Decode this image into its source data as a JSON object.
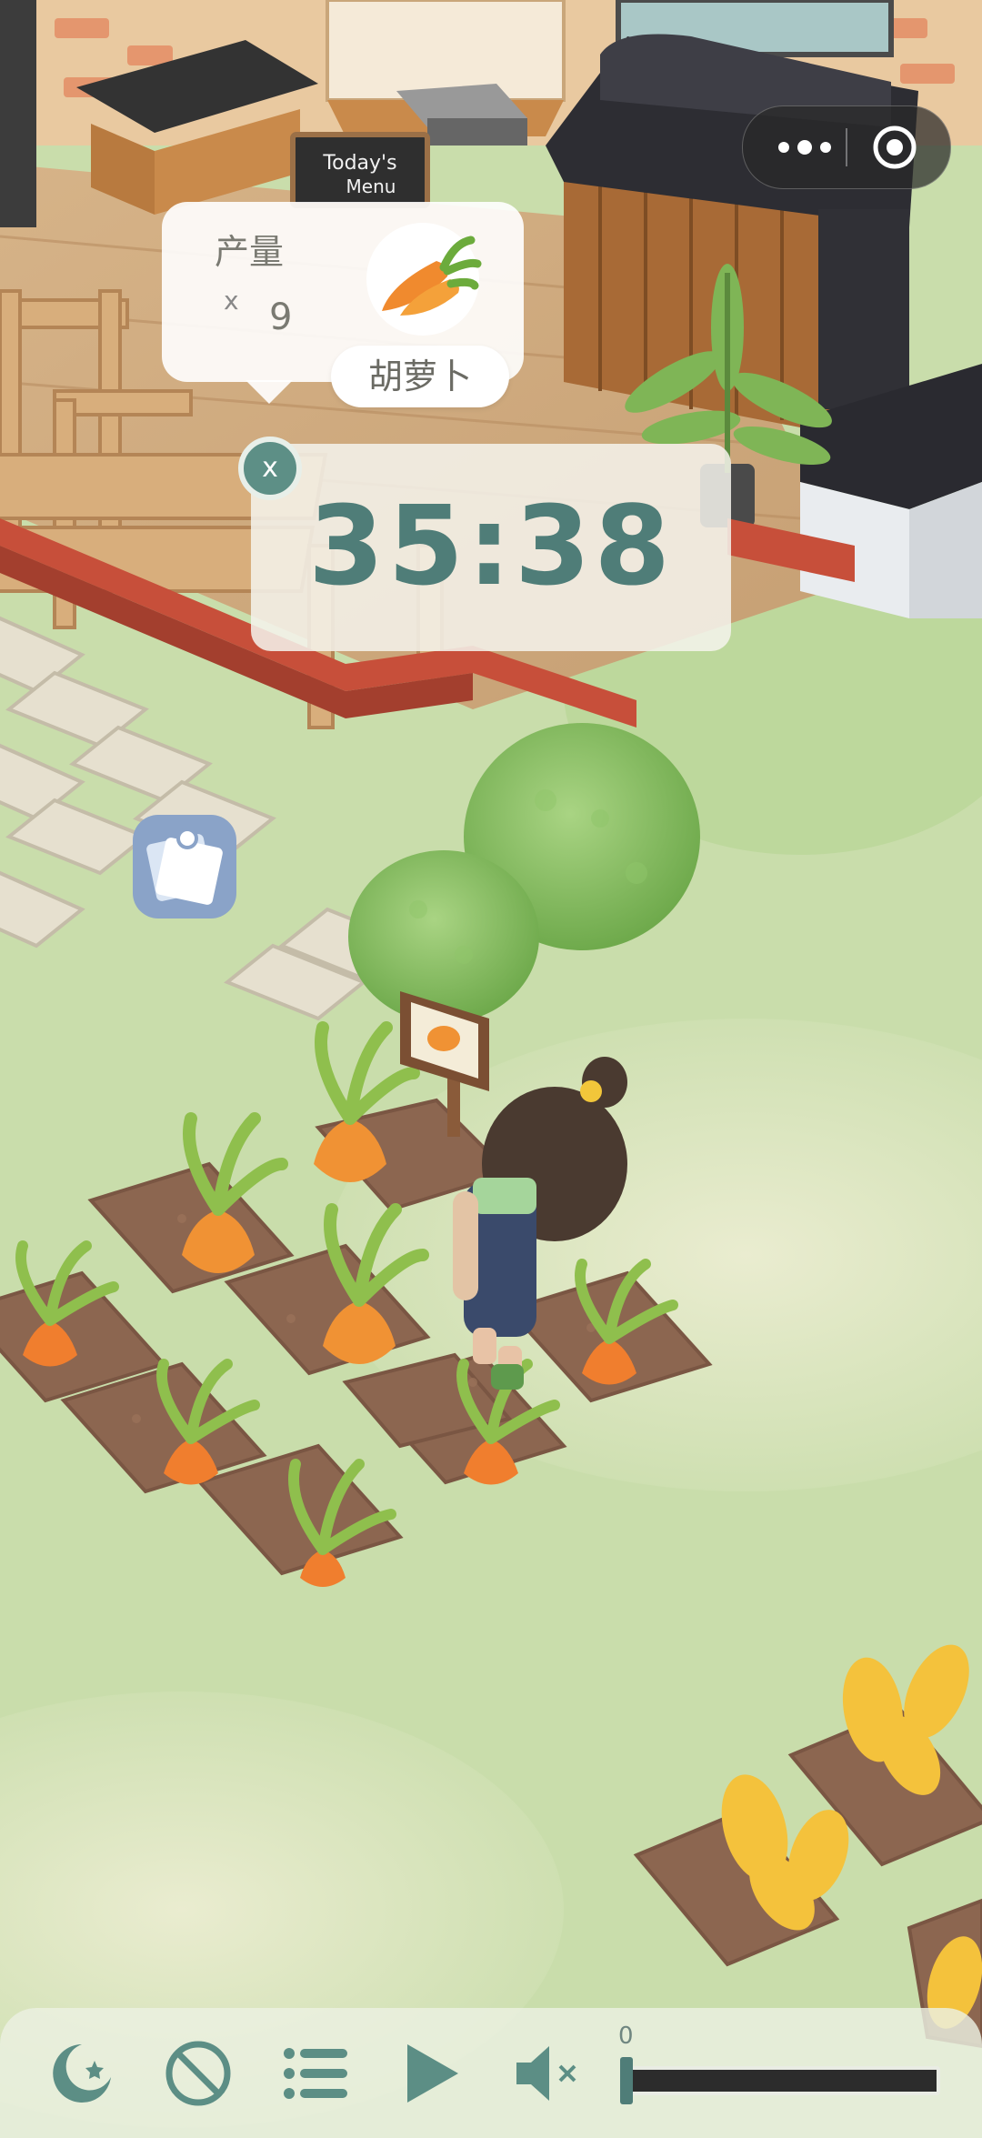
{
  "menu_board": {
    "line1": "Today's",
    "line2": "Menu"
  },
  "wechat_capsule": {
    "more_icon": "more-dots-icon",
    "close_icon": "target-circle-icon"
  },
  "yield_popup": {
    "label": "产量",
    "multiplier": "x",
    "count": "9",
    "item_name": "胡萝卜",
    "item_icon": "carrot-icon"
  },
  "timer": {
    "time": "35:38",
    "close_label": "x"
  },
  "notes_button": {
    "icon": "sticky-notes-icon"
  },
  "bottom_bar": {
    "icons": [
      "moon-stars-icon",
      "forbidden-icon",
      "list-icon",
      "play-icon",
      "speaker-muted-icon"
    ],
    "volume_label": "0",
    "volume_level": 0
  },
  "colors": {
    "accent": "#5d8f86",
    "timer_text": "#4f7d78",
    "grass": "#cfe0b4",
    "soil": "#8c6650"
  }
}
